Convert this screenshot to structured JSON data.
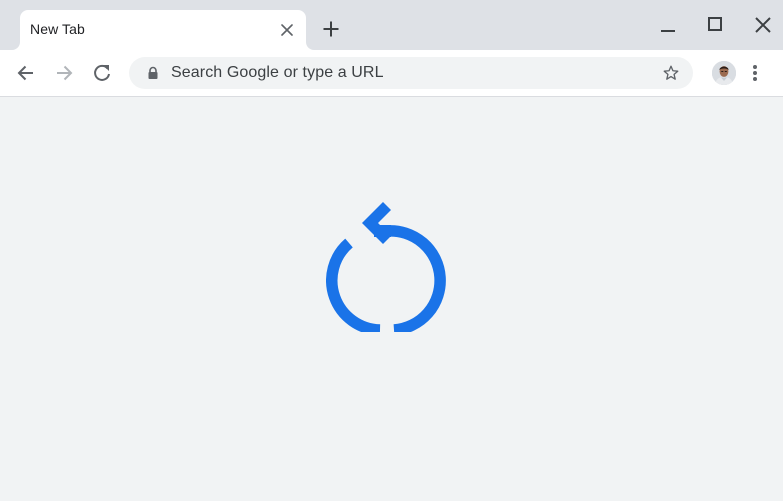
{
  "tab": {
    "title": "New Tab",
    "close_icon": "close-icon"
  },
  "tabstrip": {
    "new_tab_icon": "plus-icon"
  },
  "window_controls": {
    "minimize_icon": "minimize-icon",
    "maximize_icon": "maximize-icon",
    "close_icon": "close-icon"
  },
  "toolbar": {
    "back_icon": "arrow-back-icon",
    "forward_icon": "arrow-forward-icon",
    "reload_icon": "reload-icon",
    "forward_enabled": false
  },
  "omnibox": {
    "placeholder": "Search Google or type a URL",
    "lock_icon": "lock-icon",
    "star_icon": "star-outline-icon"
  },
  "profile": {
    "avatar": "profile-avatar"
  },
  "menu": {
    "icon": "more-vert-icon"
  },
  "content": {
    "graphic": "reload-icon",
    "accent_color": "#1a73e8"
  },
  "colors": {
    "tabstrip_bg": "#dee1e6",
    "toolbar_bg": "#ffffff",
    "omnibox_bg": "#f1f3f4",
    "page_bg": "#f1f3f4",
    "icon_color": "#5f6368",
    "icon_disabled": "#b1b5b9"
  }
}
